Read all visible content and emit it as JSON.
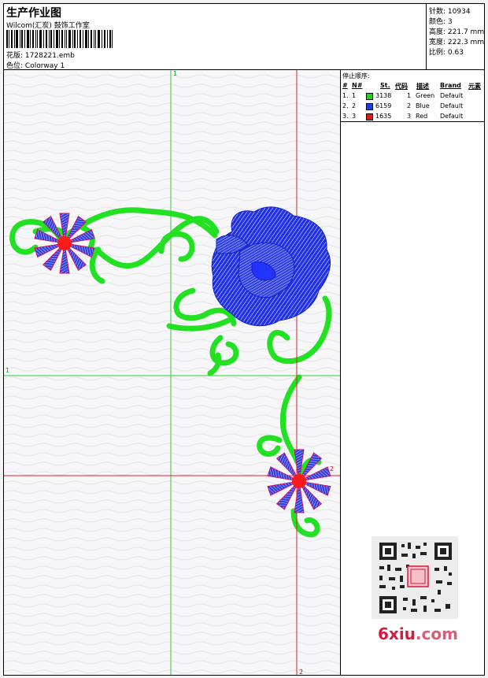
{
  "header": {
    "title": "生产作业图",
    "company": "Wilcom(汇炭) 鼓饰工作室",
    "design_label": "花版:",
    "design_value": "1728221.emb",
    "colorway_label": "色位:",
    "colorway_value": "Colorway 1"
  },
  "stats": {
    "stitches_label": "针数:",
    "stitches_value": "10934",
    "colors_label": "颜色:",
    "colors_value": "3",
    "height_label": "高度:",
    "height_value": "221.7 mm",
    "width_label": "宽度:",
    "width_value": "222.3 mm",
    "scale_label": "比例:",
    "scale_value": "0.63"
  },
  "guides": {
    "green_label": "1",
    "red_label": "2"
  },
  "stop_sequence": {
    "title": "停止顺序:",
    "headers": {
      "hash": "#",
      "number": "N#",
      "stitch": "St.",
      "code": "代码",
      "desc": "描述",
      "brand": "Brand",
      "element": "元素"
    },
    "rows": [
      {
        "index": "1.",
        "n": "1",
        "swatch": "#22cc22",
        "st": "3138",
        "code": "1",
        "desc": "Green",
        "brand": "Default"
      },
      {
        "index": "2.",
        "n": "2",
        "swatch": "#1f3fe0",
        "st": "6159",
        "code": "2",
        "desc": "Blue",
        "brand": "Default"
      },
      {
        "index": "3.",
        "n": "3",
        "swatch": "#e01a1a",
        "st": "1635",
        "code": "3",
        "desc": "Red",
        "brand": "Default"
      }
    ]
  },
  "colors": {
    "green": "#22e022",
    "blue": "#1e2ee8",
    "red": "#ff1a1a",
    "guide_green": "#33cc33",
    "guide_red": "#dd2222"
  },
  "watermark": {
    "text_a": "6xiu",
    "text_b": ".com"
  }
}
